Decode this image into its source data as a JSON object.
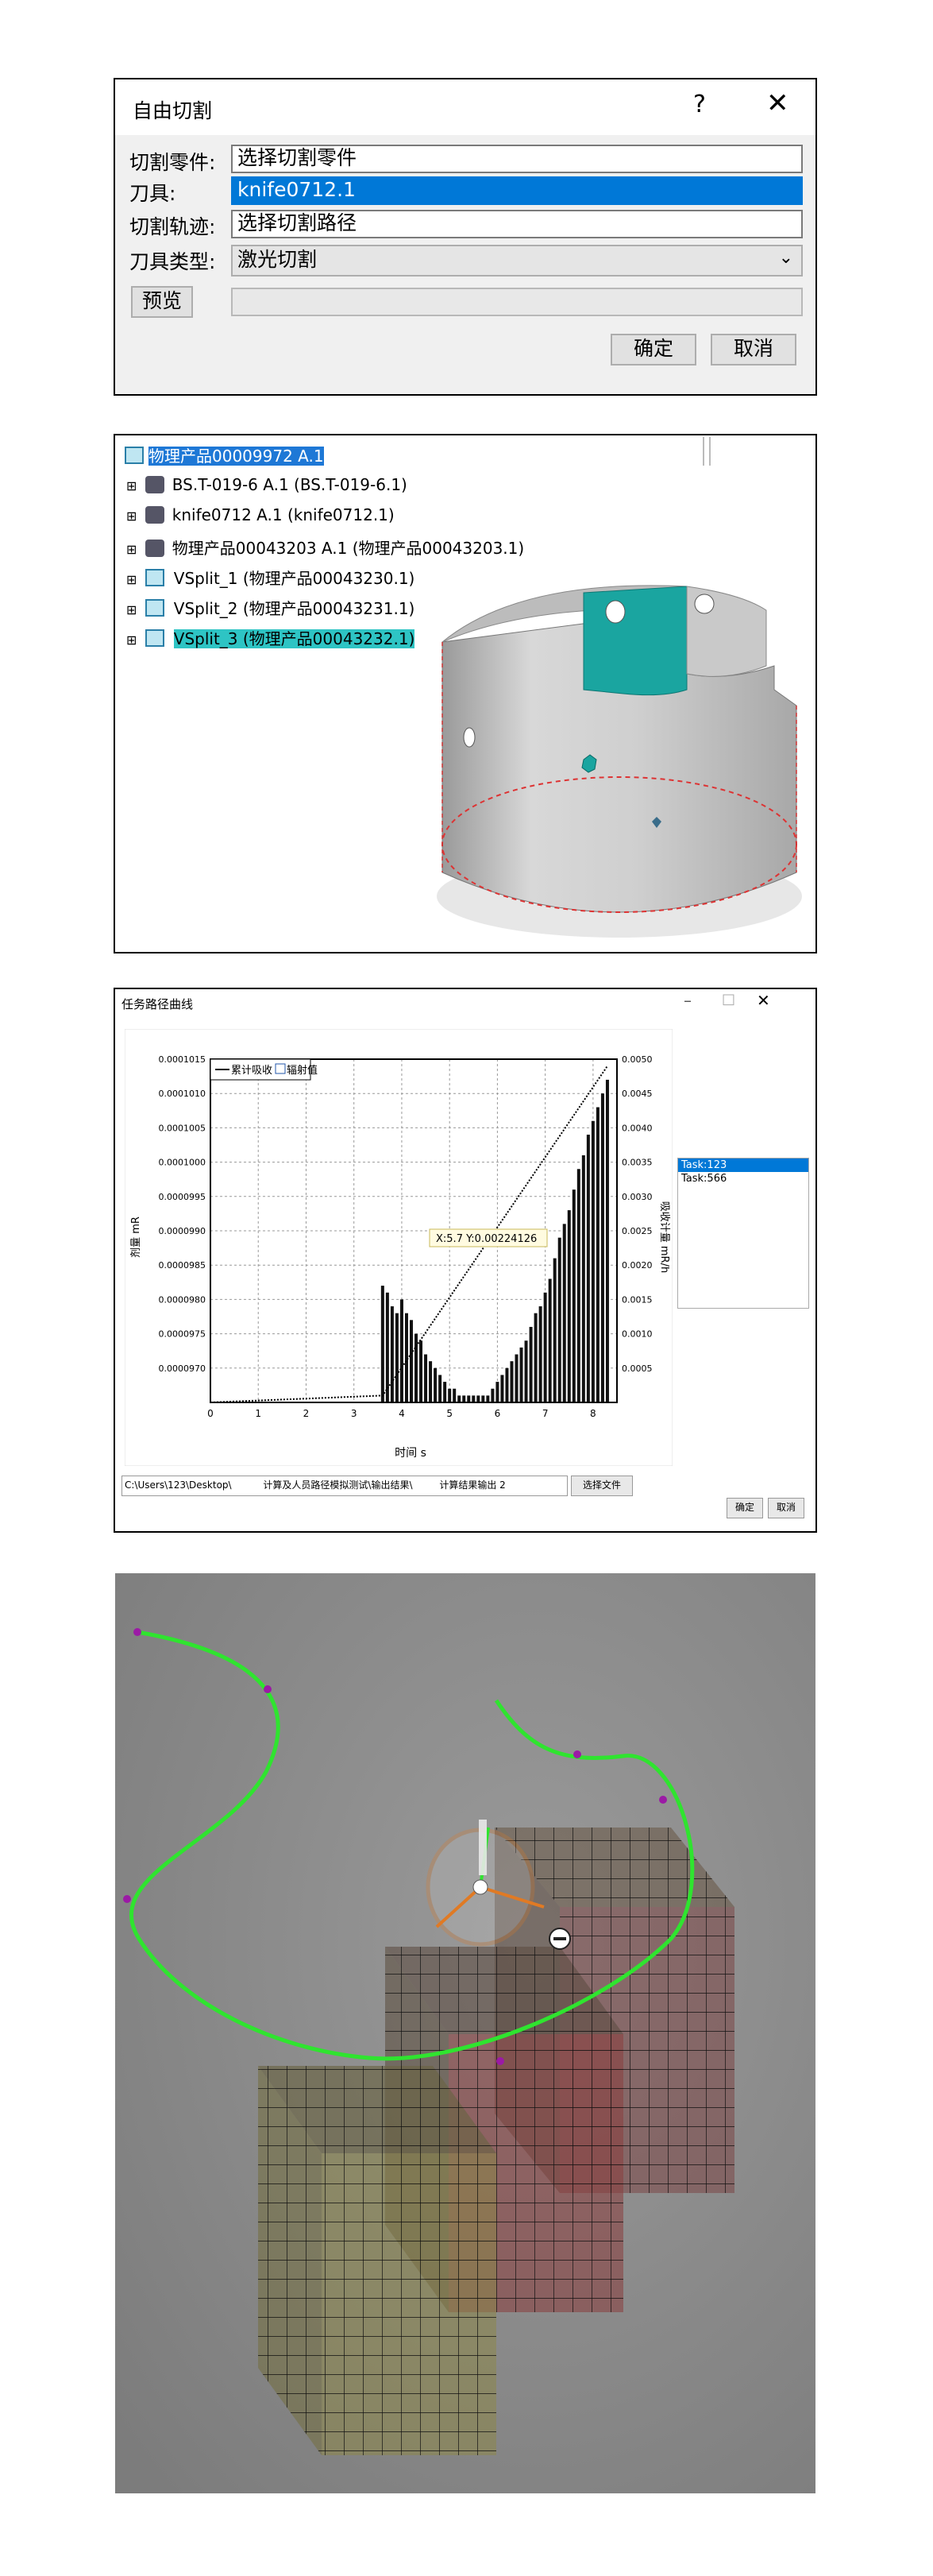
{
  "dialog": {
    "title": "自由切割",
    "help": "?",
    "close": "✕",
    "fields": [
      {
        "label": "切割零件:",
        "value": "选择切割零件"
      },
      {
        "label": "刀具:",
        "value": "knife0712.1"
      },
      {
        "label": "切割轨迹:",
        "value": "选择切割路径"
      },
      {
        "label": "刀具类型:",
        "value": "激光切割"
      }
    ],
    "preview_label": "预览",
    "ok_label": "确定",
    "cancel_label": "取消"
  },
  "tree": {
    "root": "物理产品00009972 A.1",
    "items": [
      "BS.T-019-6 A.1 (BS.T-019-6.1)",
      "knife0712 A.1 (knife0712.1)",
      "物理产品00043203 A.1 (物理产品00043203.1)",
      "VSplit_1 (物理产品00043230.1)",
      "VSplit_2 (物理产品00043231.1)",
      "VSplit_3 (物理产品00043232.1)"
    ]
  },
  "chart_window": {
    "title": "任务路径曲线",
    "path_text": "C:\\Users\\123\\Desktop\\",
    "path_text_2": "计算及人员路径模拟测试\\输出结果\\",
    "path_text_3": "计算结果输出 2",
    "select_file_label": "选择文件",
    "ok_label": "确定",
    "cancel_label": "取消",
    "tasks": [
      "Task:123",
      "Task:566"
    ],
    "tooltip": "X:5.7   Y:0.00224126"
  },
  "chart_data": {
    "type": "bar",
    "title": "",
    "xlabel": "时间 s",
    "ylabel": "剂量 mR",
    "y2label": "吸收计量 mR/h",
    "legend": [
      "累计吸收",
      "辐射值"
    ],
    "legend_position": "top-left",
    "grid": true,
    "xlim": [
      0,
      8.5
    ],
    "ylim": [
      9.65e-05,
      0.0001015
    ],
    "y2lim": [
      0,
      0.005
    ],
    "x_ticks": [
      "0",
      "1",
      "2",
      "3",
      "4",
      "5",
      "6",
      "7",
      "8"
    ],
    "y_ticks": [
      "0.0000970",
      "0.0000975",
      "0.0000980",
      "0.0000985",
      "0.0000990",
      "0.0000995",
      "0.0001000",
      "0.0001005",
      "0.0001010",
      "0.0001015"
    ],
    "y2_ticks": [
      "0.0005",
      "0.0010",
      "0.0015",
      "0.0020",
      "0.0025",
      "0.0030",
      "0.0035",
      "0.0040",
      "0.0045",
      "0.0050"
    ],
    "series": [
      {
        "name": "累计吸收",
        "type": "line",
        "x": [
          0,
          3.6,
          8.3
        ],
        "y": [
          0,
          0.0001,
          0.0049
        ]
      },
      {
        "name": "辐射值",
        "type": "bar",
        "x": [
          3.6,
          3.7,
          3.8,
          3.9,
          4.0,
          4.1,
          4.2,
          4.3,
          4.4,
          4.5,
          4.6,
          4.7,
          4.8,
          4.9,
          5.0,
          5.1,
          5.2,
          5.3,
          5.4,
          5.5,
          5.6,
          5.7,
          5.8,
          5.9,
          6.0,
          6.1,
          6.2,
          6.3,
          6.4,
          6.5,
          6.6,
          6.7,
          6.8,
          6.9,
          7.0,
          7.1,
          7.2,
          7.3,
          7.4,
          7.5,
          7.6,
          7.7,
          7.8,
          7.9,
          8.0,
          8.1,
          8.2,
          8.3
        ],
        "y": [
          9.82e-05,
          9.81e-05,
          9.79e-05,
          9.78e-05,
          9.8e-05,
          9.78e-05,
          9.77e-05,
          9.75e-05,
          9.74e-05,
          9.72e-05,
          9.71e-05,
          9.7e-05,
          9.69e-05,
          9.68e-05,
          9.67e-05,
          9.67e-05,
          9.66e-05,
          9.66e-05,
          9.66e-05,
          9.66e-05,
          9.66e-05,
          9.66e-05,
          9.66e-05,
          9.67e-05,
          9.68e-05,
          9.69e-05,
          9.7e-05,
          9.71e-05,
          9.72e-05,
          9.73e-05,
          9.74e-05,
          9.76e-05,
          9.78e-05,
          9.79e-05,
          9.81e-05,
          9.83e-05,
          9.86e-05,
          9.89e-05,
          9.91e-05,
          9.93e-05,
          9.96e-05,
          9.99e-05,
          0.0001001,
          0.0001004,
          0.0001006,
          0.0001008,
          0.000101,
          0.0001012
        ]
      }
    ]
  },
  "colors": {
    "accent": "#0078d7",
    "highlight_cyan": "#2ec4c4",
    "path_green": "#22dd22",
    "waypoint": "#9b1aa5"
  }
}
